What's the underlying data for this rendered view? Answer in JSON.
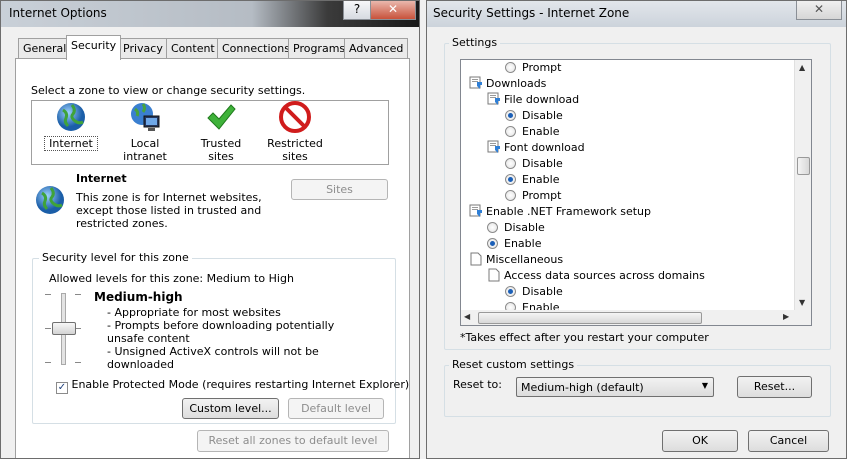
{
  "left_window": {
    "title": "Internet Options",
    "help_button": "?",
    "close_button": "✕",
    "tabs": [
      "General",
      "Security",
      "Privacy",
      "Content",
      "Connections",
      "Programs",
      "Advanced"
    ],
    "select_zone_prompt": "Select a zone to view or change security settings.",
    "zones": [
      {
        "label": "Internet",
        "icon": "globe-icon"
      },
      {
        "label": "Local intranet",
        "icon": "intranet-icon"
      },
      {
        "label": "Trusted sites",
        "icon": "checkmark-icon"
      },
      {
        "label": "Restricted sites",
        "icon": "restricted-icon"
      }
    ],
    "zone_title": "Internet",
    "zone_description": "This zone is for Internet websites, except those listed in trusted and restricted zones.",
    "sites_button": "Sites",
    "security_level_legend": "Security level for this zone",
    "allowed_levels": "Allowed levels for this zone: Medium to High",
    "level_name": "Medium-high",
    "level_bullets": [
      "- Appropriate for most websites",
      "- Prompts before downloading potentially unsafe content",
      "- Unsigned ActiveX controls will not be downloaded"
    ],
    "protected_mode_label": "Enable Protected Mode (requires restarting Internet Explorer)",
    "protected_mode_checked": true,
    "custom_level_button": "Custom level...",
    "default_level_button": "Default level",
    "reset_all_button": "Reset all zones to default level"
  },
  "right_window": {
    "title": "Security Settings - Internet Zone",
    "close_button": "✕",
    "settings_legend": "Settings",
    "tree": [
      {
        "type": "radio",
        "label": "Prompt",
        "checked": false,
        "indent": 2
      },
      {
        "type": "group",
        "label": "Downloads",
        "indent": 0
      },
      {
        "type": "group",
        "label": "File download",
        "indent": 1
      },
      {
        "type": "radio",
        "label": "Disable",
        "checked": true,
        "indent": 2
      },
      {
        "type": "radio",
        "label": "Enable",
        "checked": false,
        "indent": 2
      },
      {
        "type": "group",
        "label": "Font download",
        "indent": 1
      },
      {
        "type": "radio",
        "label": "Disable",
        "checked": false,
        "indent": 2
      },
      {
        "type": "radio",
        "label": "Enable",
        "checked": true,
        "indent": 2
      },
      {
        "type": "radio",
        "label": "Prompt",
        "checked": false,
        "indent": 2
      },
      {
        "type": "group",
        "label": "Enable .NET Framework setup",
        "indent": 0
      },
      {
        "type": "radio",
        "label": "Disable",
        "checked": false,
        "indent": 1
      },
      {
        "type": "radio",
        "label": "Enable",
        "checked": true,
        "indent": 1
      },
      {
        "type": "page",
        "label": "Miscellaneous",
        "indent": 0
      },
      {
        "type": "page",
        "label": "Access data sources across domains",
        "indent": 1
      },
      {
        "type": "radio",
        "label": "Disable",
        "checked": true,
        "indent": 2
      },
      {
        "type": "radio",
        "label": "Enable",
        "checked": false,
        "indent": 2
      }
    ],
    "restart_note": "*Takes effect after you restart your computer",
    "reset_legend": "Reset custom settings",
    "reset_to_label": "Reset to:",
    "reset_to_value": "Medium-high (default)",
    "reset_button": "Reset...",
    "ok_button": "OK",
    "cancel_button": "Cancel"
  }
}
